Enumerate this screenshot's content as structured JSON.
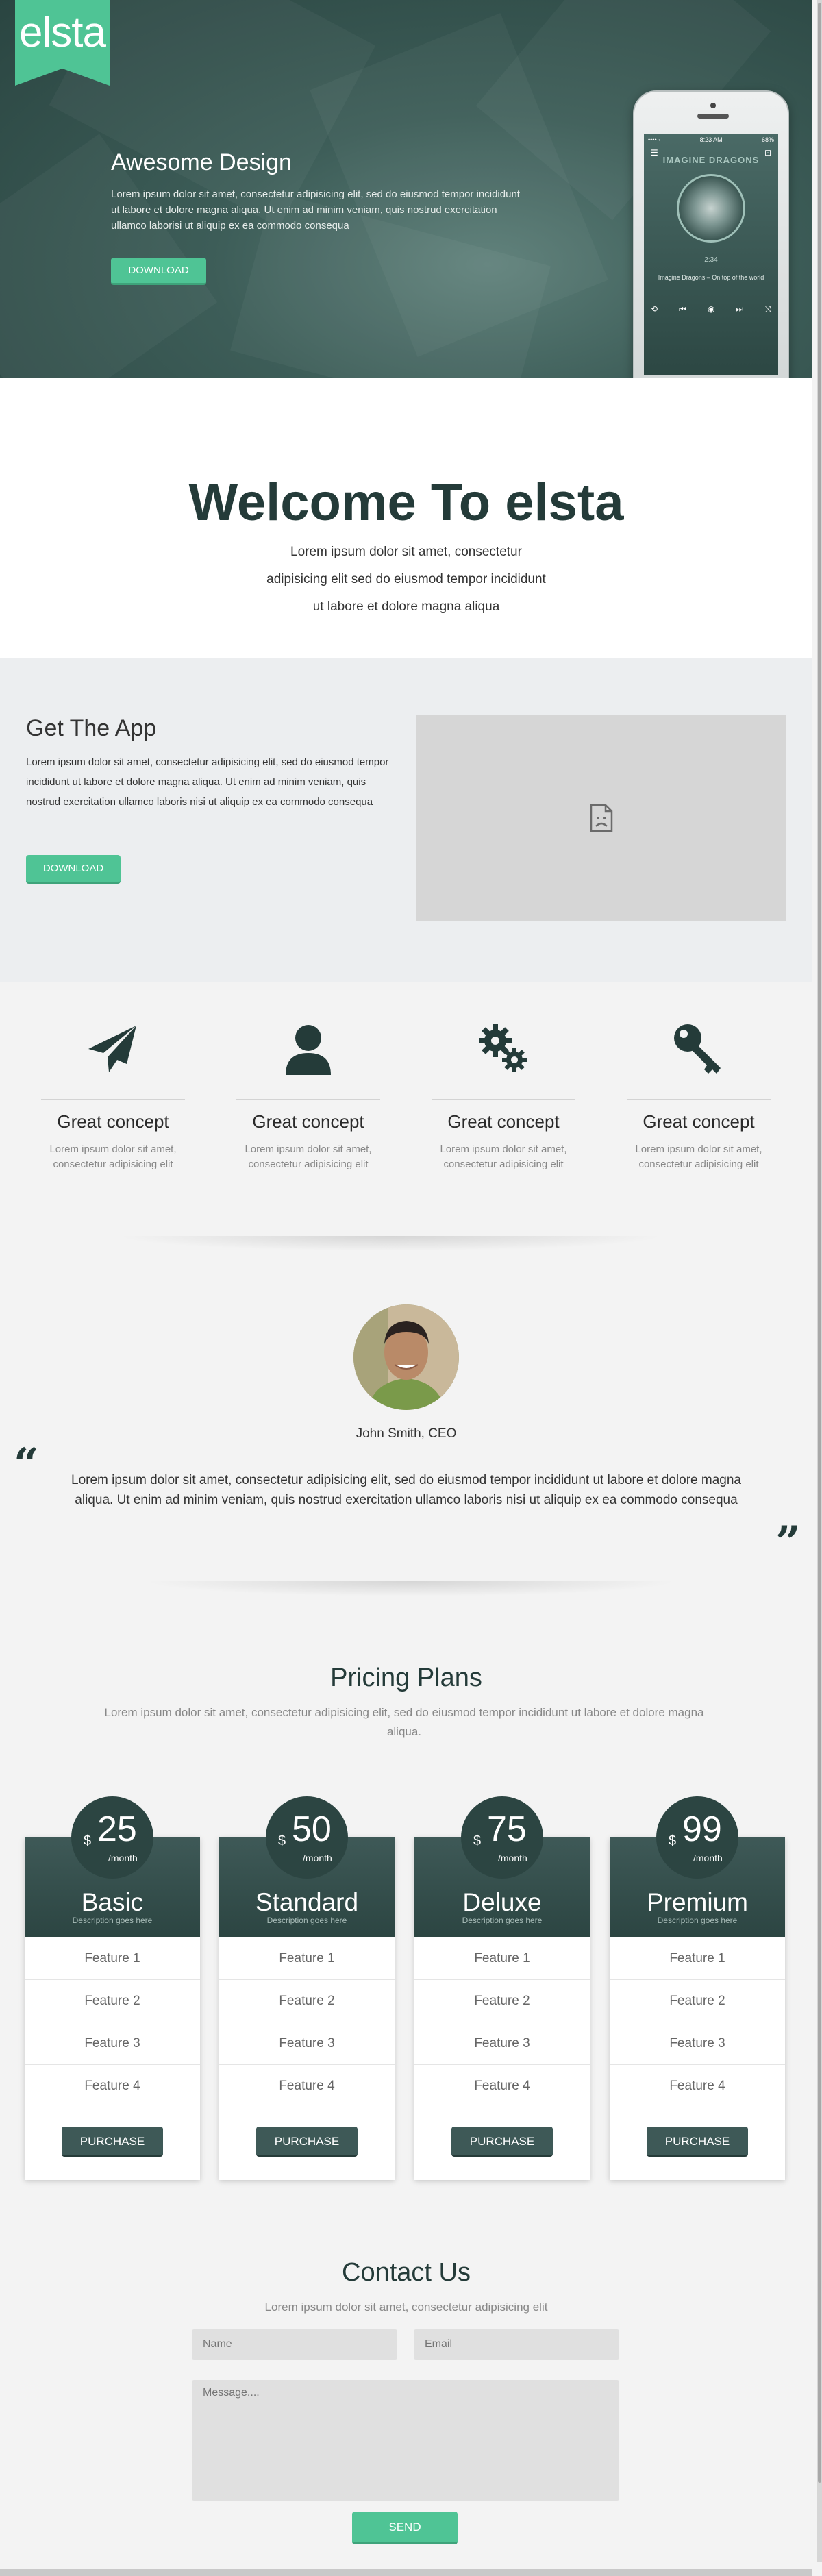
{
  "colors": {
    "accent": "#4fc495",
    "dark": "#243b39",
    "plan_header": "#3e5957"
  },
  "hero": {
    "logo": "elsta",
    "title": "Awesome Design",
    "text": "Lorem ipsum dolor sit amet, consectetur adipisicing elit, sed do eiusmod tempor incididunt ut labore et dolore magna aliqua. Ut enim ad minim veniam, quis nostrud exercitation ullamco laborisi ut aliquip ex ea commodo consequa",
    "button": "DOWNLOAD",
    "phone": {
      "carrier": "•••• ◦",
      "time": "8:23 AM",
      "battery": "68%",
      "band": "IMAGINE DRAGONS",
      "elapsed": "2:34",
      "track": "Imagine Dragons – On top of the world"
    }
  },
  "welcome": {
    "title": "Welcome To elsta",
    "text": "Lorem ipsum dolor sit amet, consectetur adipisicing elit sed do eiusmod tempor incididunt ut labore et dolore magna aliqua"
  },
  "app": {
    "title": "Get The App",
    "text": "Lorem ipsum dolor sit amet, consectetur adipisicing elit, sed do eiusmod tempor incididunt ut labore et dolore magna aliqua. Ut enim ad minim veniam, quis nostrud exercitation ullamco laboris nisi ut aliquip ex ea commodo consequa",
    "button": "DOWNLOAD"
  },
  "features": [
    {
      "icon": "paper-plane-icon",
      "title": "Great concept",
      "text": "Lorem ipsum dolor sit amet, consectetur adipisicing elit"
    },
    {
      "icon": "user-icon",
      "title": "Great concept",
      "text": "Lorem ipsum dolor sit amet, consectetur adipisicing elit"
    },
    {
      "icon": "gears-icon",
      "title": "Great concept",
      "text": "Lorem ipsum dolor sit amet, consectetur adipisicing elit"
    },
    {
      "icon": "key-icon",
      "title": "Great concept",
      "text": "Lorem ipsum dolor sit amet, consectetur adipisicing elit"
    }
  ],
  "testimonial": {
    "name": "John Smith, CEO",
    "quote": "Lorem ipsum dolor sit amet, consectetur adipisicing elit, sed do eiusmod tempor incididunt ut labore et dolore magna aliqua. Ut enim ad minim veniam, quis nostrud exercitation ullamco laboris nisi ut aliquip ex ea commodo consequa"
  },
  "pricing": {
    "title": "Pricing Plans",
    "text": "Lorem ipsum dolor sit amet, consectetur adipisicing elit, sed do eiusmod tempor incididunt ut labore et dolore magna aliqua.",
    "plans": [
      {
        "currency": "$",
        "price": "25",
        "period": "/month",
        "name": "Basic",
        "desc": "Description goes here",
        "features": [
          "Feature 1",
          "Feature 2",
          "Feature 3",
          "Feature 4"
        ],
        "button": "PURCHASE"
      },
      {
        "currency": "$",
        "price": "50",
        "period": "/month",
        "name": "Standard",
        "desc": "Description goes here",
        "features": [
          "Feature 1",
          "Feature 2",
          "Feature 3",
          "Feature 4"
        ],
        "button": "PURCHASE"
      },
      {
        "currency": "$",
        "price": "75",
        "period": "/month",
        "name": "Deluxe",
        "desc": "Description goes here",
        "features": [
          "Feature 1",
          "Feature 2",
          "Feature 3",
          "Feature 4"
        ],
        "button": "PURCHASE"
      },
      {
        "currency": "$",
        "price": "99",
        "period": "/month",
        "name": "Premium",
        "desc": "Description goes here",
        "features": [
          "Feature 1",
          "Feature 2",
          "Feature 3",
          "Feature 4"
        ],
        "button": "PURCHASE"
      }
    ]
  },
  "contact": {
    "title": "Contact Us",
    "text": "Lorem ipsum dolor sit amet, consectetur adipisicing elit",
    "name_placeholder": "Name",
    "email_placeholder": "Email",
    "message_placeholder": "Message....",
    "button": "SEND"
  }
}
